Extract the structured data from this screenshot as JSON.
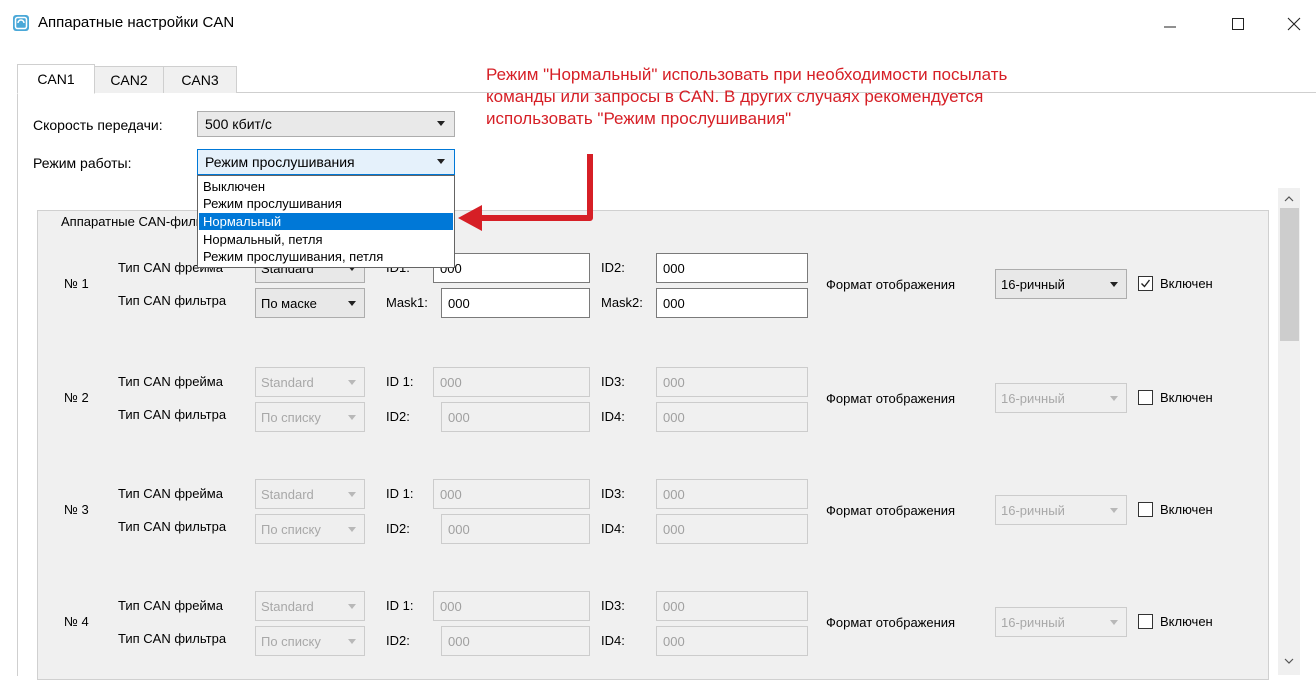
{
  "window": {
    "title": "Аппаратные настройки CAN",
    "minimize_icon": "minimize-icon",
    "maximize_icon": "maximize-icon",
    "close_icon": "close-icon"
  },
  "tabs": [
    {
      "label": "CAN1",
      "active": true
    },
    {
      "label": "CAN2",
      "active": false
    },
    {
      "label": "CAN3",
      "active": false
    }
  ],
  "settings": {
    "speed_label": "Скорость передачи:",
    "speed_value": "500 кбит/с",
    "mode_label": "Режим работы:",
    "mode_value": "Режим прослушивания",
    "mode_options": [
      "Выключен",
      "Режим прослушивания",
      "Нормальный",
      "Нормальный, петля",
      "Режим прослушивания, петля"
    ],
    "mode_highlighted": "Нормальный"
  },
  "annotation": {
    "lines": [
      "Режим \"Нормальный\" использовать при необходимости посылать",
      "команды или запросы в CAN. В других случаях рекомендуется",
      "использовать \"Режим прослушивания\""
    ],
    "color": "#d61f26"
  },
  "group": {
    "title": "Аппаратные CAN-фильтры"
  },
  "filters": [
    {
      "number": "№ 1",
      "frame_type_label": "Тип CAN фрейма",
      "frame_type": "Standard",
      "filter_type_label": "Тип CAN фильтра",
      "filter_type": "По маске",
      "id1_label": "ID1:",
      "id1": "000",
      "id2_label": "ID2:",
      "id2": "000",
      "id3_label": "Mask1:",
      "id3": "000",
      "id4_label": "Mask2:",
      "id4": "000",
      "format_label": "Формат отображения",
      "format": "16-ричный",
      "enabled_label": "Включен",
      "enabled": true
    },
    {
      "number": "№ 2",
      "frame_type_label": "Тип CAN фрейма",
      "frame_type": "Standard",
      "filter_type_label": "Тип CAN фильтра",
      "filter_type": "По списку",
      "id1_label": "ID 1:",
      "id1": "000",
      "id2_label": "ID3:",
      "id2": "000",
      "id3_label": "ID2:",
      "id3": "000",
      "id4_label": "ID4:",
      "id4": "000",
      "format_label": "Формат отображения",
      "format": "16-ричный",
      "enabled_label": "Включен",
      "enabled": false
    },
    {
      "number": "№ 3",
      "frame_type_label": "Тип CAN фрейма",
      "frame_type": "Standard",
      "filter_type_label": "Тип CAN фильтра",
      "filter_type": "По списку",
      "id1_label": "ID 1:",
      "id1": "000",
      "id2_label": "ID3:",
      "id2": "000",
      "id3_label": "ID2:",
      "id3": "000",
      "id4_label": "ID4:",
      "id4": "000",
      "format_label": "Формат отображения",
      "format": "16-ричный",
      "enabled_label": "Включен",
      "enabled": false
    },
    {
      "number": "№ 4",
      "frame_type_label": "Тип CAN фрейма",
      "frame_type": "Standard",
      "filter_type_label": "Тип CAN фильтра",
      "filter_type": "По списку",
      "id1_label": "ID 1:",
      "id1": "000",
      "id2_label": "ID3:",
      "id2": "000",
      "id3_label": "ID2:",
      "id3": "000",
      "id4_label": "ID4:",
      "id4": "000",
      "format_label": "Формат отображения",
      "format": "16-ричный",
      "enabled_label": "Включен",
      "enabled": false
    }
  ]
}
